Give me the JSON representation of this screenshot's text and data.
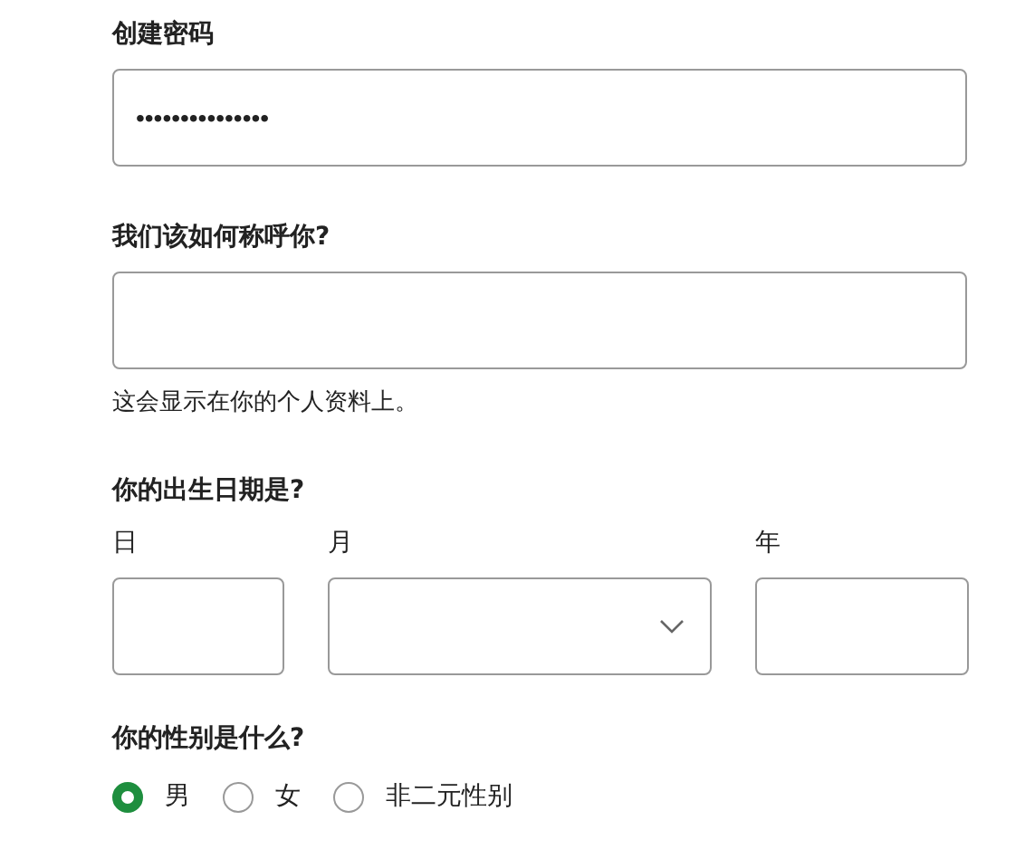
{
  "password": {
    "label": "创建密码",
    "value": "•••••••••••••••"
  },
  "name": {
    "label": "我们该如何称呼你?",
    "hint": "这会显示在你的个人资料上。"
  },
  "birthday": {
    "label": "你的出生日期是?",
    "fields": [
      {
        "label": "日",
        "kind": "input"
      },
      {
        "label": "月",
        "kind": "select"
      },
      {
        "label": "年",
        "kind": "input"
      }
    ]
  },
  "gender": {
    "label": "你的性别是什么?",
    "options": [
      {
        "label": "男",
        "selected": true
      },
      {
        "label": "女",
        "selected": false
      },
      {
        "label": "非二元性别",
        "selected": false
      }
    ]
  }
}
